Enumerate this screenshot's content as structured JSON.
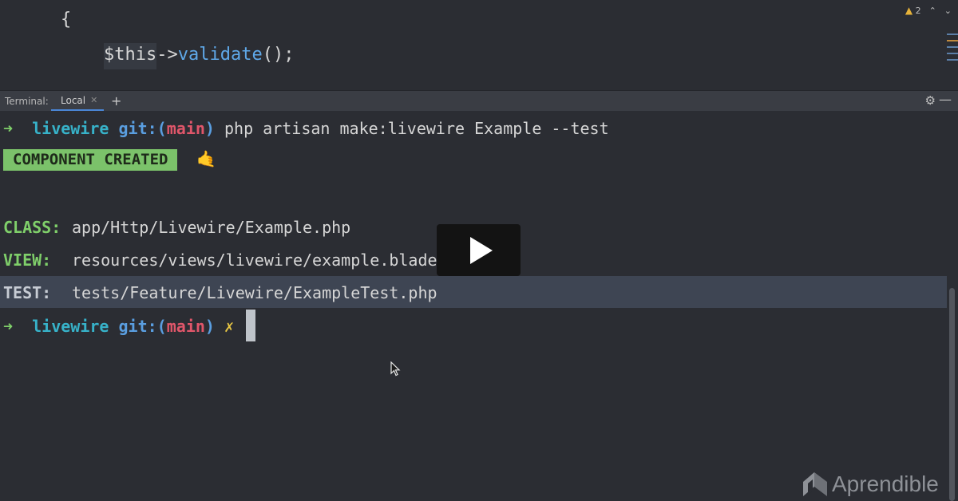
{
  "editor": {
    "brace": "{",
    "this_part": "$this",
    "arrow_op": "->",
    "method": "validate",
    "tail": "();",
    "warning_count": "2"
  },
  "terminal_bar": {
    "label": "Terminal:",
    "tab_label": "Local",
    "add_symbol": "+"
  },
  "terminal": {
    "prompt_arrow": "➜",
    "dir": "livewire",
    "git_prefix": "git:(",
    "branch": "main",
    "git_suffix": ")",
    "command": "php artisan make:livewire Example --test",
    "badge": "COMPONENT CREATED",
    "emoji": "🤙",
    "rows": [
      {
        "key": "CLASS:",
        "value": "app/Http/Livewire/Example.php"
      },
      {
        "key": "VIEW:",
        "value": "resources/views/livewire/example.blade.php"
      },
      {
        "key": "TEST:",
        "value": "tests/Feature/Livewire/ExampleTest.php"
      }
    ],
    "dirty_mark": "✗"
  },
  "brand": {
    "name": "Aprendible"
  },
  "colors": {
    "background": "#2b2d33",
    "green": "#7bc26a",
    "cyan": "#37b2c9",
    "red": "#e0566a",
    "blue": "#5a9ee0",
    "highlight_row": "#3e4553"
  }
}
